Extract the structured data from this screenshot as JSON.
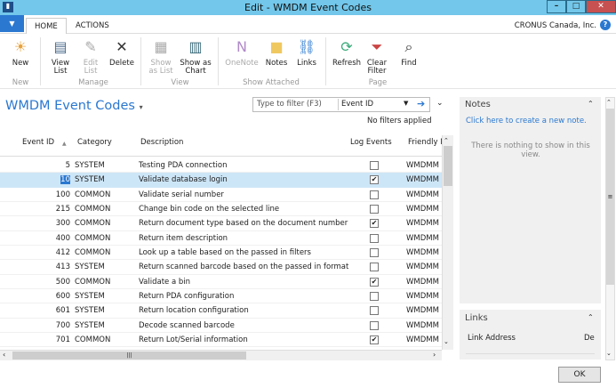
{
  "window": {
    "title": "Edit - WMDM Event Codes",
    "minimize": "–",
    "maximize": "□",
    "close": "✕"
  },
  "tabs": [
    {
      "label": "HOME"
    },
    {
      "label": "ACTIONS"
    }
  ],
  "company": "CRONUS Canada, Inc.",
  "help": "?",
  "ribbon": {
    "buttons": [
      {
        "label": "New",
        "icon": "☀"
      },
      {
        "label": "View\nList",
        "icon": "▤"
      },
      {
        "label": "Edit\nList",
        "icon": "✎"
      },
      {
        "label": "Delete",
        "icon": "✕"
      },
      {
        "label": "Show\nas List",
        "icon": "▦"
      },
      {
        "label": "Show as\nChart",
        "icon": "▥"
      },
      {
        "label": "OneNote",
        "icon": "N"
      },
      {
        "label": "Notes",
        "icon": "■"
      },
      {
        "label": "Links",
        "icon": "⛓"
      },
      {
        "label": "Refresh",
        "icon": "⟳"
      },
      {
        "label": "Clear\nFilter",
        "icon": "⏷"
      },
      {
        "label": "Find",
        "icon": "⌕"
      }
    ],
    "groups": [
      "New",
      "Manage",
      "View",
      "Show Attached",
      "Page"
    ]
  },
  "page": {
    "title": "WMDM Event Codes",
    "filter_placeholder": "Type to filter (F3)",
    "filter_field": "Event ID",
    "no_filters": "No filters applied"
  },
  "table": {
    "headers": [
      "Event ID",
      "Category",
      "Description",
      "Log Events",
      "Friendly N"
    ],
    "rows": [
      {
        "id": "5",
        "category": "SYSTEM",
        "description": "Testing PDA connection",
        "log": false,
        "friendly": "WMDMM"
      },
      {
        "id": "10",
        "category": "SYSTEM",
        "description": "Validate database login",
        "log": true,
        "friendly": "WMDMM"
      },
      {
        "id": "100",
        "category": "COMMON",
        "description": "Validate serial number",
        "log": false,
        "friendly": "WMDMM"
      },
      {
        "id": "215",
        "category": "COMMON",
        "description": "Change bin code on the selected line",
        "log": false,
        "friendly": "WMDMM"
      },
      {
        "id": "300",
        "category": "COMMON",
        "description": "Return document type based on the document number",
        "log": true,
        "friendly": "WMDMM"
      },
      {
        "id": "400",
        "category": "COMMON",
        "description": "Return item description",
        "log": false,
        "friendly": "WMDMM"
      },
      {
        "id": "412",
        "category": "COMMON",
        "description": "Look up a table based on the passed in filters",
        "log": false,
        "friendly": "WMDMM"
      },
      {
        "id": "413",
        "category": "SYSTEM",
        "description": "Return scanned barcode based on the passed in format",
        "log": false,
        "friendly": "WMDMM"
      },
      {
        "id": "500",
        "category": "COMMON",
        "description": "Validate a bin",
        "log": true,
        "friendly": "WMDMM"
      },
      {
        "id": "600",
        "category": "SYSTEM",
        "description": "Return PDA configuration",
        "log": false,
        "friendly": "WMDMM"
      },
      {
        "id": "601",
        "category": "SYSTEM",
        "description": "Return location configuration",
        "log": false,
        "friendly": "WMDMM"
      },
      {
        "id": "700",
        "category": "SYSTEM",
        "description": "Decode scanned barcode",
        "log": false,
        "friendly": "WMDMM"
      },
      {
        "id": "701",
        "category": "COMMON",
        "description": "Return Lot/Serial information",
        "log": true,
        "friendly": "WMDMM"
      }
    ]
  },
  "notes": {
    "title": "Notes",
    "create_link": "Click here to create a new note.",
    "empty": "There is nothing to show in this view."
  },
  "links": {
    "title": "Links",
    "col1": "Link Address",
    "col2": "De"
  },
  "ok": "OK",
  "colors": {
    "accent": "#2a78d0",
    "titlebar": "#72c7ea",
    "selected": "#cde6f7"
  }
}
